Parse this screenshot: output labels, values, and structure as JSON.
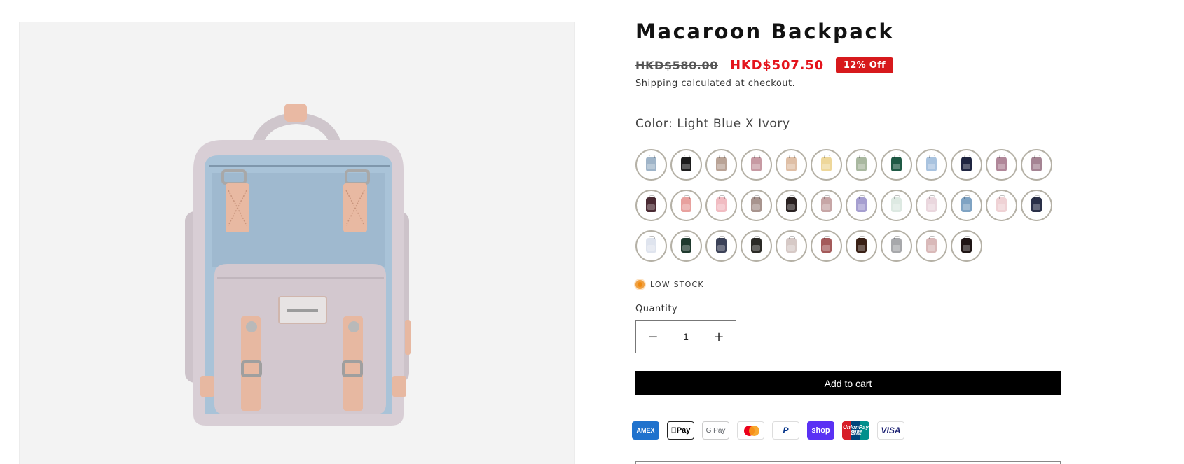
{
  "product": {
    "title": "Macaroon Backpack",
    "compare_price": "HKD$580.00",
    "sale_price": "HKD$507.50",
    "badge": "12% Off",
    "shipping_link": "Shipping",
    "shipping_rest": " calculated at checkout.",
    "color_label": "Color: Light Blue X Ivory",
    "stock": "LOW STOCK",
    "quantity_label": "Quantity",
    "quantity_value": "1",
    "decrease_symbol": "−",
    "increase_symbol": "+",
    "add_to_cart": "Add to cart"
  },
  "colors": {
    "accent": "#000000",
    "sale": "#e4141c",
    "badge": "#d7191c",
    "low_stock": "#f08a10"
  },
  "swatches": [
    "#9fb4c8",
    "#1c1c1c",
    "#b9a396",
    "#c79aa3",
    "#dfbfa6",
    "#eed79a",
    "#a9b8a0",
    "#1f5a45",
    "#a9c3df",
    "#1f2541",
    "#b08799",
    "#a58493",
    "#4a2a33",
    "#e8a19e",
    "#f1bcc2",
    "#a8948e",
    "#2a2222",
    "#c7a6a6",
    "#a69fd0",
    "#dde9e2",
    "#ead7de",
    "#7fa3c3",
    "#efd2d5",
    "#2a3048",
    "#dfe4ee",
    "#1f3a2e",
    "#3c4258",
    "#2b2a26",
    "#d6c9c6",
    "#a45a5a",
    "#3a2116",
    "#a7a8ab",
    "#d9b9b9",
    "#1f1515"
  ],
  "payments": [
    {
      "name": "amex",
      "label": "AMEX"
    },
    {
      "name": "apple-pay",
      "label": "Pay"
    },
    {
      "name": "google-pay",
      "label": "G Pay"
    },
    {
      "name": "mastercard",
      "label": ""
    },
    {
      "name": "paypal",
      "label": "P"
    },
    {
      "name": "shop-pay",
      "label": "shop"
    },
    {
      "name": "unionpay",
      "label": "UnionPay 银联"
    },
    {
      "name": "visa",
      "label": "VISA"
    }
  ],
  "icons": {
    "apple": "apple-icon",
    "backpack": "backpack-image"
  }
}
